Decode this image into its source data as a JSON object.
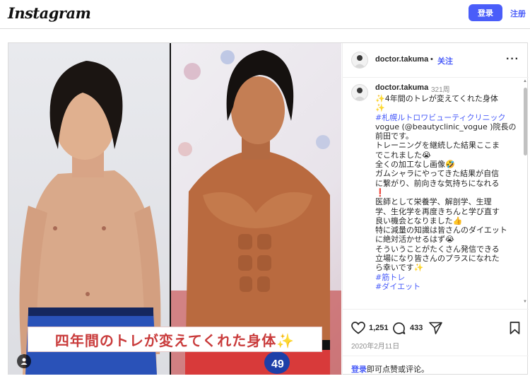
{
  "topbar": {
    "logo": "Instagram",
    "login_label": "登录",
    "signup_label": "注册"
  },
  "post": {
    "image_banner_text": "四年間のトレが変えてくれた身体✨",
    "author": "doctor.takuma",
    "follow_label": "关注",
    "dot": "•",
    "caption": {
      "username": "doctor.takuma",
      "time": "321周",
      "lines": [
        {
          "text": "✨4年間のトレが変えてくれた身体",
          "link": false
        },
        {
          "text": "✨",
          "link": false
        },
        {
          "text": "#札幌ルトロワビューティクリニック",
          "link": true
        },
        {
          "text": "vogue (@beautyclinic_vogue )院長の",
          "link": false
        },
        {
          "text": "前田です。",
          "link": false
        },
        {
          "text": "トレーニングを継続した結果ここま",
          "link": false
        },
        {
          "text": "でこれました😭",
          "link": false
        },
        {
          "text": "全くの加工なし画像🤣",
          "link": false
        },
        {
          "text": "ガムシャラにやってきた結果が自信",
          "link": false
        },
        {
          "text": "に繋がり、前向きな気持ちになれる",
          "link": false
        },
        {
          "text": "❗",
          "link": false
        },
        {
          "text": "医師として栄養学、解剖学、生理",
          "link": false
        },
        {
          "text": "学、生化学を再度きちんと学び直す",
          "link": false
        },
        {
          "text": "良い機会となりました👍",
          "link": false
        },
        {
          "text": "特に減量の知識は皆さんのダイエット",
          "link": false
        },
        {
          "text": "に絶対活かせるはず😭",
          "link": false
        },
        {
          "text": "そういうことがたくさん発信できる",
          "link": false
        },
        {
          "text": "立場になり皆さんのプラスになれた",
          "link": false
        },
        {
          "text": "ら幸いです✨",
          "link": false
        },
        {
          "text": "#筋トレ",
          "link": true
        },
        {
          "text": "#ダイエット",
          "link": true
        }
      ]
    },
    "likes": "1,251",
    "comments": "433",
    "date": "2020年2月11日",
    "login_prompt_link": "登录",
    "login_prompt_text": "即可点赞或评论。"
  },
  "icons": [
    "heart-icon",
    "comment-icon",
    "share-icon",
    "bookmark-icon",
    "more-icon",
    "user-tag-icon"
  ]
}
